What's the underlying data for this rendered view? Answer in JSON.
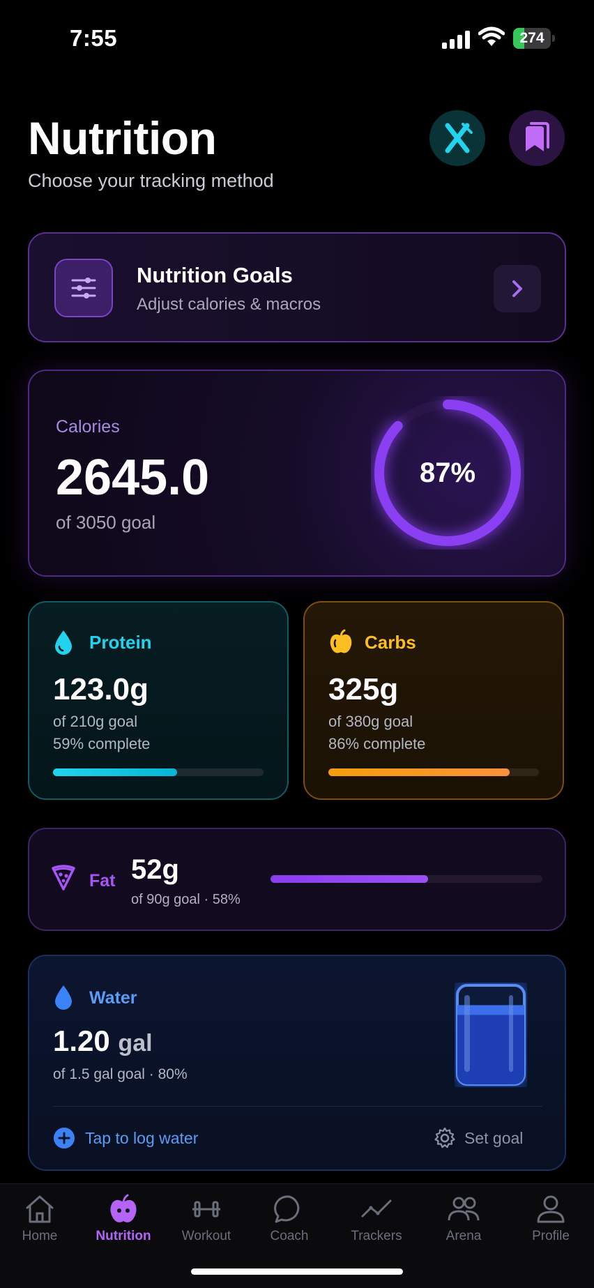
{
  "status_bar": {
    "time": "7:55",
    "battery": "274",
    "battery_level": 0.3
  },
  "header": {
    "title": "Nutrition",
    "subtitle": "Choose your tracking method",
    "utensils_icon": "utensils-icon",
    "bookmark_icon": "bookmark-icon"
  },
  "goals_card": {
    "title": "Nutrition Goals",
    "subtitle": "Adjust calories & macros",
    "icon": "sliders-icon"
  },
  "calories": {
    "label": "Calories",
    "value": "2645.0",
    "goal": "of 3050 goal",
    "percent_label": "87%",
    "percent": 0.87
  },
  "protein": {
    "name": "Protein",
    "value": "123.0g",
    "goal": "of 210g goal",
    "complete": "59% complete",
    "progress": 0.59,
    "color": "#22d3ee"
  },
  "carbs": {
    "name": "Carbs",
    "value": "325g",
    "goal": "of 380g goal",
    "complete": "86% complete",
    "progress": 0.86,
    "color": "#fbbf24"
  },
  "fat": {
    "name": "Fat",
    "value": "52g",
    "goal": "of 90g goal · 58%",
    "progress": 0.58,
    "color": "#a855f7"
  },
  "water": {
    "name": "Water",
    "value": "1.20",
    "unit": "gal",
    "goal": "of 1.5 gal goal · 80%",
    "progress": 0.8,
    "log_label": "Tap to log water",
    "set_goal_label": "Set goal"
  },
  "tabs": [
    {
      "label": "Home",
      "icon": "home-icon",
      "active": false
    },
    {
      "label": "Nutrition",
      "icon": "apple-icon",
      "active": true
    },
    {
      "label": "Workout",
      "icon": "dumbbell-icon",
      "active": false
    },
    {
      "label": "Coach",
      "icon": "chat-icon",
      "active": false
    },
    {
      "label": "Trackers",
      "icon": "trend-icon",
      "active": false
    },
    {
      "label": "Arena",
      "icon": "users-icon",
      "active": false
    },
    {
      "label": "Profile",
      "icon": "user-icon",
      "active": false
    }
  ],
  "colors": {
    "accent": "#a855f7",
    "background": "#000000"
  }
}
